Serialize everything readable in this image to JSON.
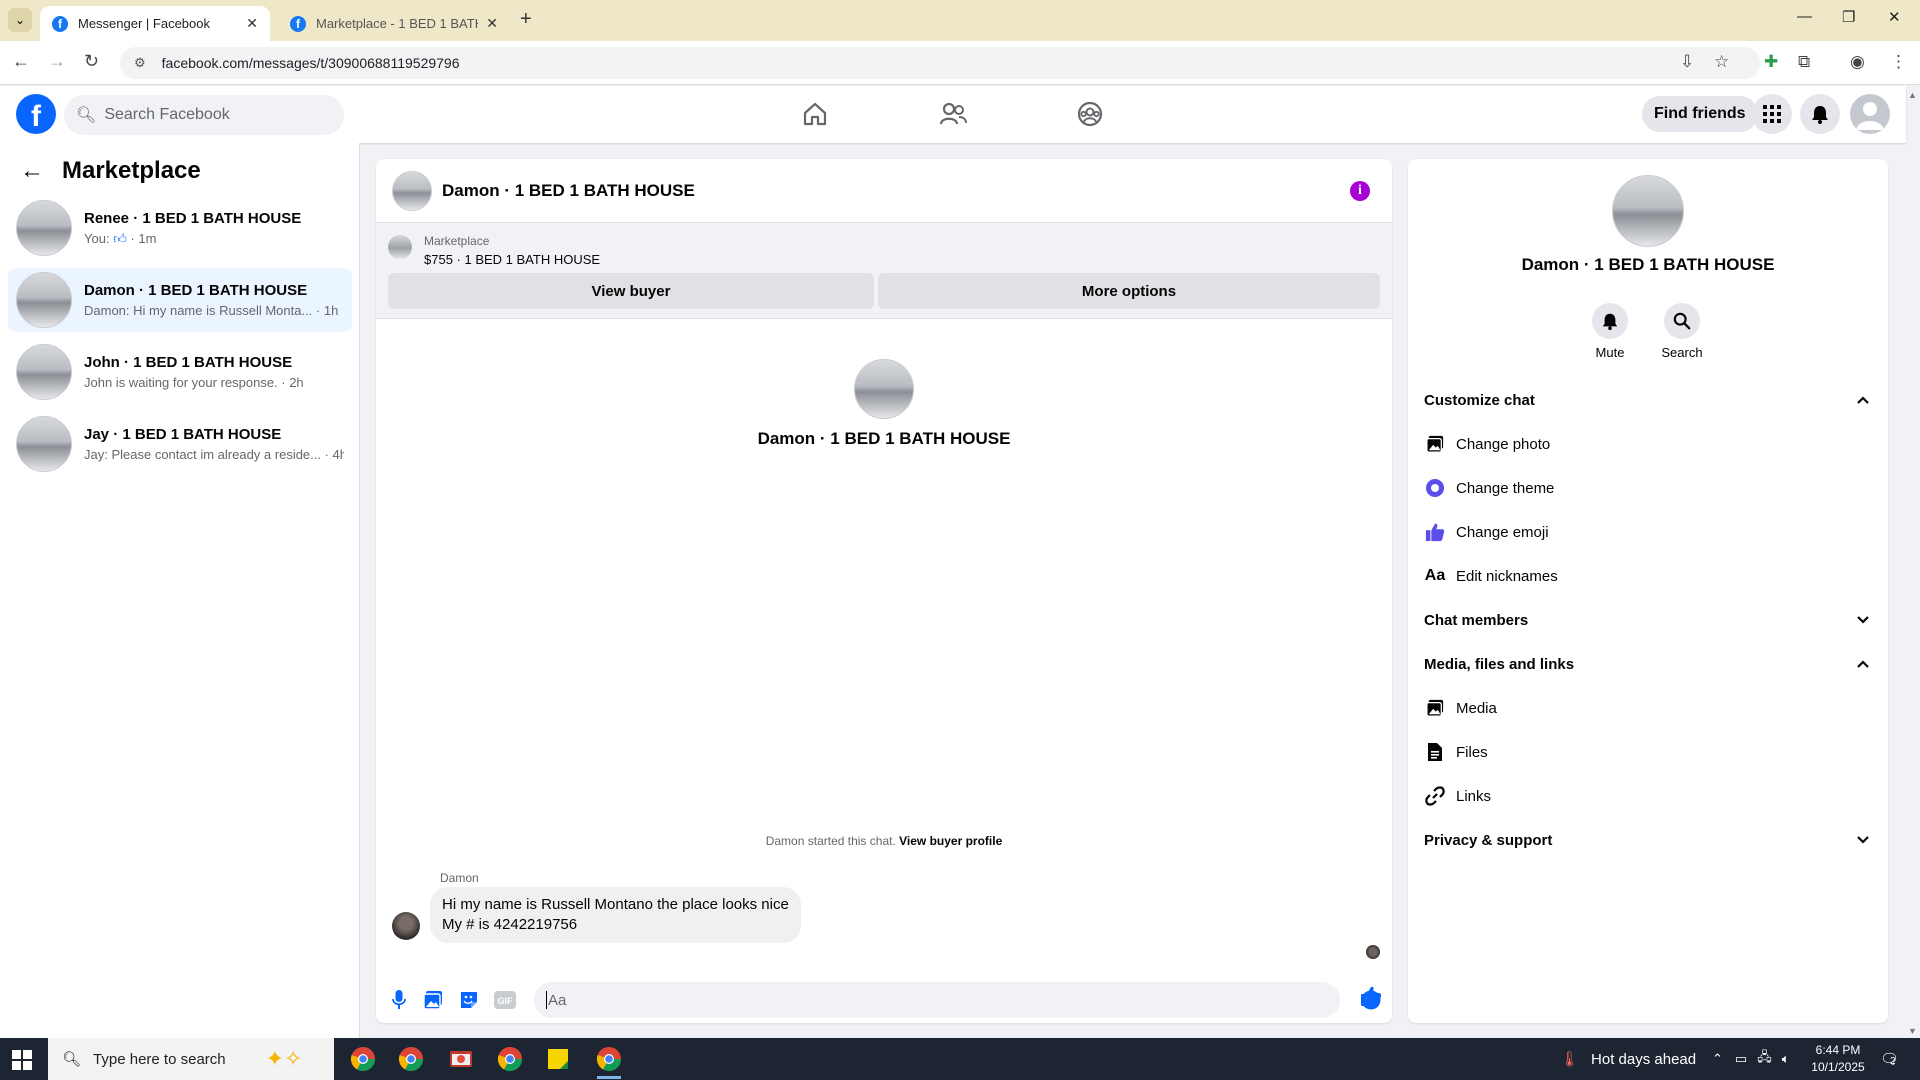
{
  "browser": {
    "tabs": [
      {
        "title": "Messenger | Facebook",
        "active": true
      },
      {
        "title": "Marketplace - 1 BED 1 BATH HO",
        "active": false
      }
    ],
    "url": "facebook.com/messages/t/30900688119529796"
  },
  "fb_header": {
    "logo": "f",
    "search_placeholder": "Search Facebook",
    "find_friends": "Find friends"
  },
  "sidebar": {
    "title": "Marketplace",
    "conversations": [
      {
        "name": "Renee · 1 BED 1 BATH HOUSE",
        "snippet_prefix": "You:",
        "snippet_suffix": "· 1m",
        "has_like": true
      },
      {
        "name": "Damon · 1 BED 1 BATH HOUSE",
        "snippet": "Damon: Hi my name is Russell Monta... · 1h",
        "selected": true
      },
      {
        "name": "John · 1 BED 1 BATH HOUSE",
        "snippet": "John is waiting for your response. · 2h"
      },
      {
        "name": "Jay · 1 BED 1 BATH HOUSE",
        "snippet": "Jay: Please contact im already a reside... · 4h"
      }
    ]
  },
  "chat": {
    "title": "Damon · 1 BED 1 BATH HOUSE",
    "listing_label": "Marketplace",
    "listing_price_title": "$755 · 1 BED 1 BATH HOUSE",
    "view_buyer": "View buyer",
    "more_options": "More options",
    "intro_name": "Damon · 1 BED 1 BATH HOUSE",
    "started_text": "Damon started this chat.",
    "view_buyer_profile": "View buyer profile",
    "sender": "Damon",
    "message_line1": "Hi my name is Russell Montano the place looks nice",
    "message_line2": "My # is 4242219756",
    "composer_placeholder": "Aa"
  },
  "right_panel": {
    "name": "Damon · 1 BED 1 BATH HOUSE",
    "mute": "Mute",
    "search": "Search",
    "customize_chat": "Customize chat",
    "change_photo": "Change photo",
    "change_theme": "Change theme",
    "change_emoji": "Change emoji",
    "aa": "Aa",
    "edit_nicknames": "Edit nicknames",
    "chat_members": "Chat members",
    "media_files_links": "Media, files and links",
    "media": "Media",
    "files": "Files",
    "links": "Links",
    "privacy_support": "Privacy & support"
  },
  "taskbar": {
    "search_placeholder": "Type here to search",
    "weather": "Hot days ahead",
    "time": "6:44 PM",
    "date": "10/1/2025",
    "notification_count": "2"
  },
  "colors": {
    "facebook_blue": "#0866ff",
    "info_purple": "#a600d6",
    "theme_purple": "#5b4ee8",
    "selected_bg": "#ebf5ff",
    "taskbar": "#1c2531"
  }
}
